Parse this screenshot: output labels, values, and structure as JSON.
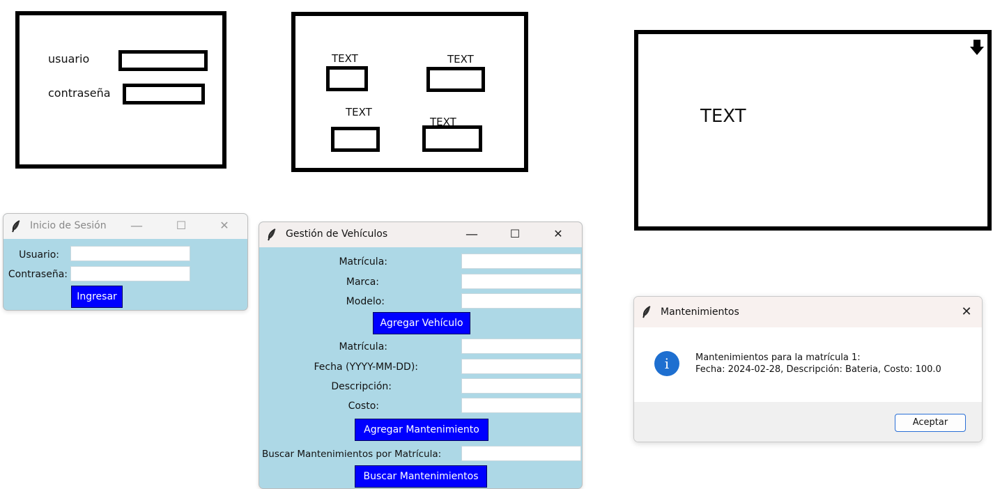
{
  "sketch_login": {
    "usuario_label": "usuario",
    "contrasena_label": "contraseña"
  },
  "sketch_vehicles": {
    "labels": [
      "TEXT",
      "TEXT",
      "TEXT",
      "TEXT"
    ]
  },
  "sketch_message": {
    "text": "TEXT",
    "corner_icon": "arrow-down-icon"
  },
  "login_window": {
    "title": "Inicio de Sesión",
    "usuario_label": "Usuario:",
    "contrasena_label": "Contraseña:",
    "ingresar_button": "Ingresar",
    "usuario_value": "",
    "contrasena_value": ""
  },
  "vehicles_window": {
    "title": "Gestión de Vehículos",
    "matricula_label": "Matrícula:",
    "marca_label": "Marca:",
    "modelo_label": "Modelo:",
    "agregar_vehiculo_button": "Agregar Vehículo",
    "mant_matricula_label": "Matrícula:",
    "fecha_label": "Fecha (YYYY-MM-DD):",
    "descripcion_label": "Descripción:",
    "costo_label": "Costo:",
    "agregar_mantenimiento_button": "Agregar Mantenimiento",
    "buscar_label": "Buscar Mantenimientos por Matrícula:",
    "buscar_button": "Buscar Mantenimientos",
    "button_color": "#0000ff",
    "background_color": "#add8e6"
  },
  "dialog": {
    "title": "Mantenimientos",
    "line1": "Mantenimientos para la matrícula 1:",
    "line2": "Fecha: 2024-02-28, Descripción: Bateria, Costo: 100.0",
    "accept_button": "Aceptar",
    "icon": "info-icon"
  }
}
